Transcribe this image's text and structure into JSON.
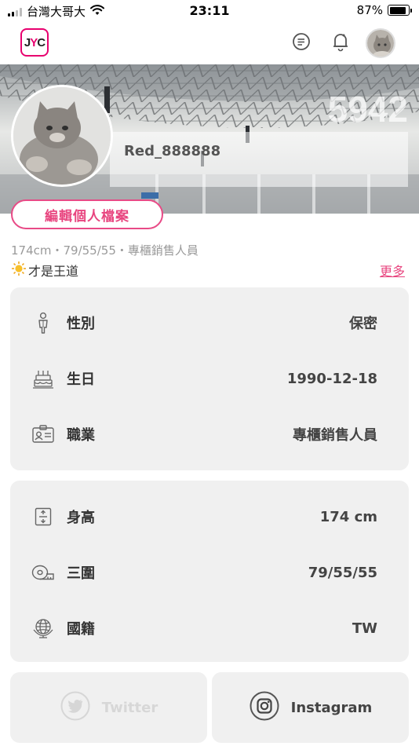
{
  "status_bar": {
    "carrier": "台灣大哥大",
    "time": "23:11",
    "battery": "87%",
    "battery_level": 0.87
  },
  "header": {
    "logo_text_j": "J",
    "logo_text_y": "Y",
    "logo_text_c": "C",
    "icons": [
      "chat-icon",
      "notification-bell-icon",
      "user-avatar"
    ]
  },
  "profile": {
    "banner_count": "5942",
    "username": "Red_888888",
    "edit_button": "編輯個人檔案",
    "meta": "174cm・79/55/55・專櫃銷售人員",
    "bio": "才是王道",
    "more_link": "更多"
  },
  "basic_info": [
    {
      "icon": "person-icon",
      "label": "性別",
      "value": "保密"
    },
    {
      "icon": "birthday-cake-icon",
      "label": "生日",
      "value": "1990-12-18"
    },
    {
      "icon": "id-card-icon",
      "label": "職業",
      "value": "專櫃銷售人員"
    }
  ],
  "body_info": [
    {
      "icon": "height-icon",
      "label": "身高",
      "value": "174 cm"
    },
    {
      "icon": "tape-measure-icon",
      "label": "三圍",
      "value": "79/55/55"
    },
    {
      "icon": "globe-icon",
      "label": "國籍",
      "value": "TW"
    }
  ],
  "social": {
    "twitter": "Twitter",
    "instagram": "Instagram"
  },
  "colors": {
    "accent": "#e8457f",
    "card_bg": "#f0f0f0"
  }
}
